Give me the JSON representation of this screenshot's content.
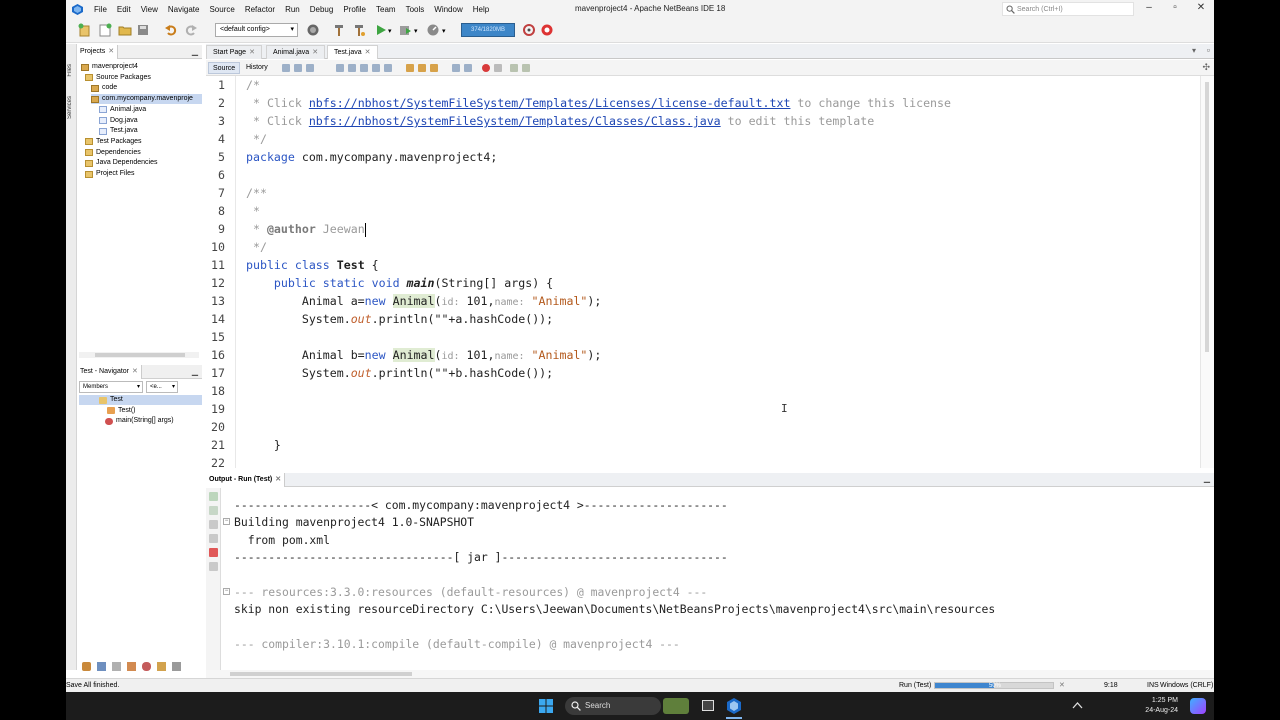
{
  "window": {
    "title": "mavenproject4 - Apache NetBeans IDE 18",
    "search_placeholder": "Search (Ctrl+I)"
  },
  "menu": [
    "File",
    "Edit",
    "View",
    "Navigate",
    "Source",
    "Refactor",
    "Run",
    "Debug",
    "Profile",
    "Team",
    "Tools",
    "Window",
    "Help"
  ],
  "toolbar": {
    "config_selected": "<default config>",
    "memory_label": "374/1820MB"
  },
  "side_strip": [
    "Files",
    "Services"
  ],
  "projects": {
    "tab_label": "Projects",
    "tree": [
      {
        "label": "mavenproject4",
        "icon": "project-icon"
      },
      {
        "label": "Source Packages",
        "icon": "folder-icon"
      },
      {
        "label": "code",
        "icon": "package-icon"
      },
      {
        "label": "com.mycompany.mavenproje",
        "icon": "package-icon"
      },
      {
        "label": "Animal.java",
        "icon": "java-file-icon"
      },
      {
        "label": "Dog.java",
        "icon": "java-file-icon"
      },
      {
        "label": "Test.java",
        "icon": "java-file-icon"
      },
      {
        "label": "Test Packages",
        "icon": "folder-icon"
      },
      {
        "label": "Dependencies",
        "icon": "folder-icon"
      },
      {
        "label": "Java Dependencies",
        "icon": "folder-icon"
      },
      {
        "label": "Project Files",
        "icon": "folder-icon"
      }
    ]
  },
  "navigator": {
    "tab_label": "Test - Navigator",
    "filter_selected": "Members",
    "filter2_selected": "<e...",
    "tree": [
      {
        "label": "Test",
        "icon": "class-icon"
      },
      {
        "label": "Test()",
        "icon": "constructor-icon"
      },
      {
        "label": "main(String[] args)",
        "icon": "method-icon"
      }
    ]
  },
  "editor": {
    "tabs": [
      "Start Page",
      "Animal.java",
      "Test.java"
    ],
    "active_tab": "Test.java",
    "view_tabs": [
      "Source",
      "History"
    ],
    "line_numbers": [
      "1",
      "2",
      "3",
      "4",
      "5",
      "6",
      "7",
      "8",
      "9",
      "10",
      "11",
      "12",
      "13",
      "14",
      "15",
      "16",
      "17",
      "18",
      "19",
      "20",
      "21",
      "22"
    ],
    "code": {
      "l1": "/*",
      "l2_pre": " * Click ",
      "l2_link": "nbfs://nbhost/SystemFileSystem/Templates/Licenses/license-default.txt",
      "l2_post": " to change this license",
      "l3_pre": " * Click ",
      "l3_link": "nbfs://nbhost/SystemFileSystem/Templates/Classes/Class.java",
      "l3_post": " to edit this template",
      "l4": " */",
      "l5_kw": "package",
      "l5_rest": " com.mycompany.mavenproject4;",
      "l7": "/**",
      "l8": " *",
      "l9_pre": " * ",
      "l9_tag": "@author",
      "l9_name": " Jeewan",
      "l10": " */",
      "l11_kw": "public class",
      "l11_name": "Test",
      "l11_post": " {",
      "l12_kw": "    public static void",
      "l12_name": "main",
      "l12_post": "(String[] args) {",
      "l13_pre": "        Animal a=",
      "l13_new": "new",
      "l13_cls": "Animal",
      "l13_p1": "id:",
      "l13_v1": " 101,",
      "l13_p2": "name:",
      "l13_str": " \"Animal\"",
      "l13_post": ");",
      "l14_pre": "        System.",
      "l14_out": "out",
      "l14_post": ".println(\"\"+a.hashCode());",
      "l16_pre": "        Animal b=",
      "l16_new": "new",
      "l16_cls": "Animal",
      "l16_p1": "id:",
      "l16_v1": " 101,",
      "l16_p2": "name:",
      "l16_str": " \"Animal\"",
      "l16_post": ");",
      "l17_pre": "        System.",
      "l17_out": "out",
      "l17_post": ".println(\"\"+b.hashCode());",
      "l21": "    }"
    }
  },
  "output": {
    "tab_label": "Output - Run (Test)",
    "lines": [
      "--------------------< com.mycompany:mavenproject4 >---------------------",
      "Building mavenproject4 1.0-SNAPSHOT",
      "  from pom.xml",
      "--------------------------------[ jar ]---------------------------------",
      "",
      "--- resources:3.3.0:resources (default-resources) @ mavenproject4 ---",
      "skip non existing resourceDirectory C:\\Users\\Jeewan\\Documents\\NetBeansProjects\\mavenproject4\\src\\main\\resources",
      "",
      "--- compiler:3.10.1:compile (default-compile) @ mavenproject4 ---"
    ]
  },
  "status": {
    "message": "Save All finished.",
    "task": "Run (Test)",
    "progress_label": "50%",
    "progress": 0.5,
    "cursor_pos": "9:18",
    "mode": "INS",
    "line_endings": "Windows (CRLF)"
  },
  "taskbar": {
    "search_label": "Search",
    "time": "1:25 PM",
    "date": "24-Aug-24"
  }
}
